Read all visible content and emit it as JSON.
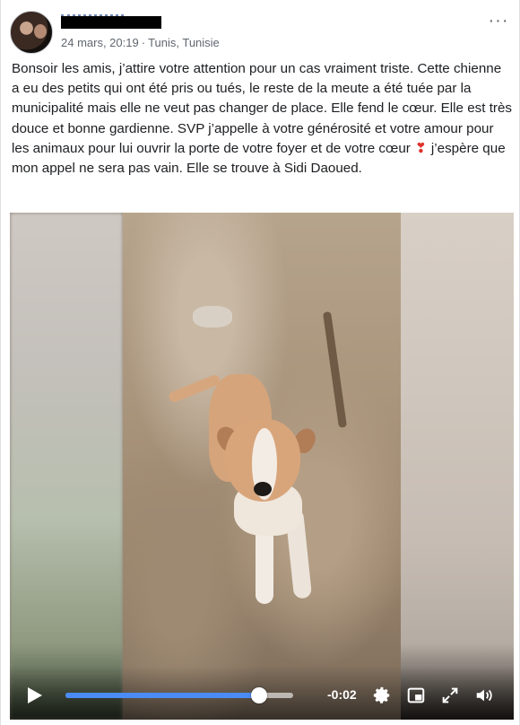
{
  "post": {
    "author_redacted": true,
    "date": "24 mars, 20:19",
    "separator": "·",
    "location": "Tunis, Tunisie",
    "more_label": "···",
    "text_part1": "Bonsoir les amis, j’attire votre attention pour un cas vraiment triste. Cette chienne a eu des petits qui ont été pris ou tués, le reste de la meute a été tuée par la municipalité mais elle ne veut pas changer de place. Elle fend le cœur. Elle est très douce et bonne gardienne. SVP j’appelle à votre générosité et votre amour pour les animaux pour lui ouvrir la porte de votre foyer et de votre cœur",
    "heart": "❣",
    "text_part2": " j’espère que mon appel ne sera pas vain. Elle se trouve à Sidi Daoued."
  },
  "video": {
    "time_remaining": "-0:02",
    "progress": 0.85,
    "colors": {
      "progress": "#4a8bf5",
      "track": "#ffffff"
    },
    "icons": [
      "play-icon",
      "settings-icon",
      "picture-in-picture-icon",
      "fullscreen-icon",
      "volume-icon"
    ]
  }
}
